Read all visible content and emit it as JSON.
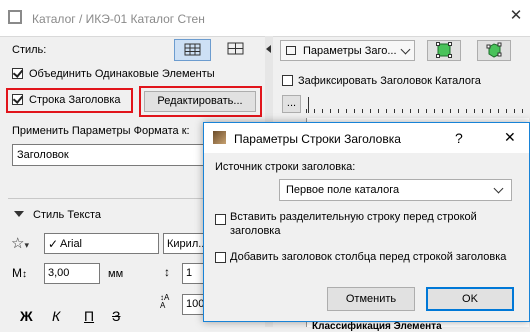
{
  "window": {
    "title": "Каталог / ИКЭ-01 Каталог Стен"
  },
  "left_panel": {
    "style_label": "Стиль:",
    "merge_checkbox": {
      "label": "Объединить Одинаковые Элементы",
      "checked": true
    },
    "header_row_checkbox": {
      "label": "Строка Заголовка",
      "checked": true
    },
    "edit_button": "Редактировать...",
    "apply_format_label": "Применить Параметры Формата к:",
    "apply_format_value": "Заголовок",
    "text_style_section": "Стиль Текста",
    "font_name": "Arial",
    "encoding": "Кирил...",
    "size_value": "3,00",
    "size_unit": "мм",
    "field_1_value": "1",
    "field_2_value": "100",
    "format_buttons": [
      "Ж",
      "К",
      "П",
      "З"
    ]
  },
  "right_panel": {
    "header_params_dropdown": "Параметры Заго...",
    "lock_header_checkbox": {
      "label": "Зафиксировать Заголовок Каталога",
      "checked": false
    },
    "ellipsis_button": "...",
    "table_snippet": "Классификация Элемента"
  },
  "dialog": {
    "title": "Параметры Строки Заголовка",
    "help_button": "?",
    "close_button": "✕",
    "source_label": "Источник строки заголовка:",
    "source_value": "Первое поле каталога",
    "insert_separator_checkbox": {
      "label_line1": "Вставить разделительную строку перед строкой",
      "label_line2": "заголовка",
      "checked": false
    },
    "add_column_header_checkbox": {
      "label": "Добавить заголовок столбца перед строкой заголовка",
      "checked": false
    },
    "cancel_button": "Отменить",
    "ok_button": "OK"
  },
  "colors": {
    "highlight_red": "#e1141b",
    "accent_blue": "#0078d7",
    "dialog_border": "#1883d7"
  }
}
